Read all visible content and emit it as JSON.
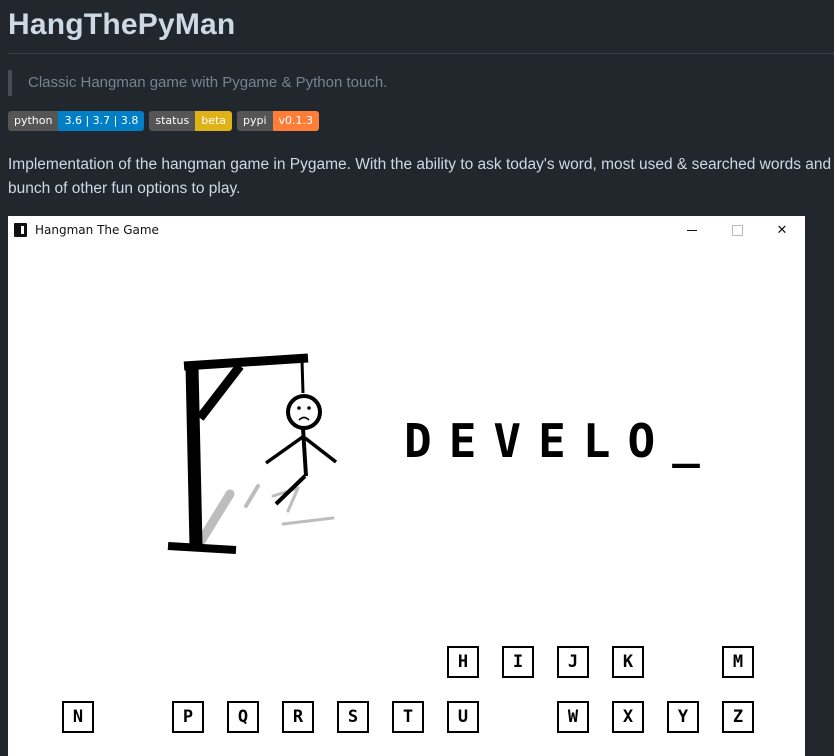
{
  "readme": {
    "title": "HangThePyMan",
    "tagline": "Classic Hangman game with Pygame & Python touch.",
    "badges": [
      {
        "key": "python",
        "value": "3.6 | 3.7 | 3.8",
        "color": "#007ec6"
      },
      {
        "key": "status",
        "value": "beta",
        "color": "#dfb317"
      },
      {
        "key": "pypi",
        "value": "v0.1.3",
        "color": "#fe7d37"
      }
    ],
    "description": "Implementation of the hangman game in Pygame. With the ability to ask today's word, most used & searched words and bunch of other fun options to play."
  },
  "window": {
    "title": "Hangman The Game",
    "minimize_icon": "minimize-icon",
    "maximize_icon": "maximize-icon",
    "close_glyph": "✕"
  },
  "game": {
    "word_display": "DEVELO_",
    "keys_row1": [
      "H",
      "I",
      "J",
      "K",
      "M"
    ],
    "keys_row2": [
      "N",
      "P",
      "Q",
      "R",
      "S",
      "T",
      "U",
      "W",
      "X",
      "Y",
      "Z"
    ]
  }
}
